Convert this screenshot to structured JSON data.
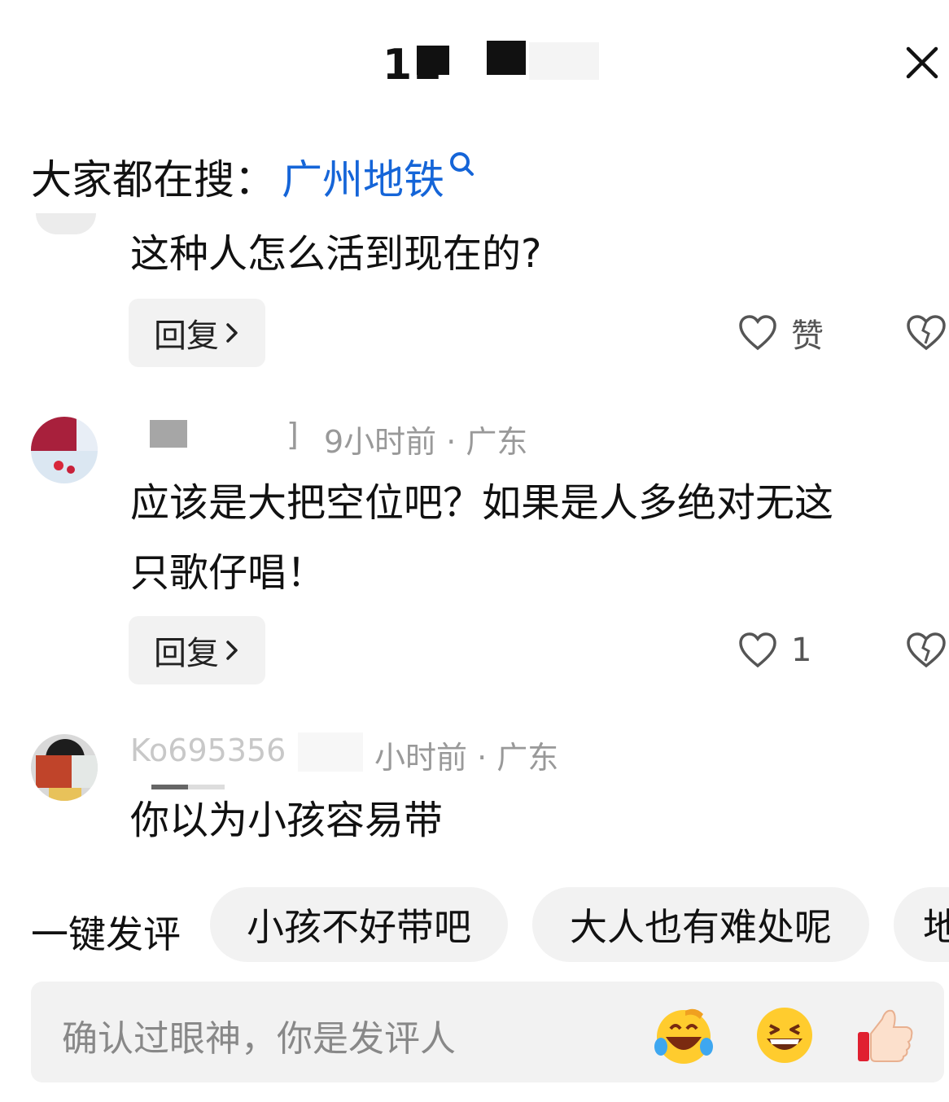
{
  "header": {
    "title": "11"
  },
  "hot_search": {
    "label": "大家都在搜：",
    "term": "广州地铁"
  },
  "comments": [
    {
      "text": "这种人怎么活到现在的?",
      "reply_label": "回复",
      "like_label": "赞"
    },
    {
      "username_suffix": "]",
      "meta": "9小时前 · 广东",
      "text_line1": "应该是大把空位吧？如果是人多绝对无这",
      "text_line2": "只歌仔唱！",
      "reply_label": "回复",
      "like_count": "1"
    },
    {
      "username_partial": "Ko695356",
      "meta": "小时前 · 广东",
      "text": "你以为小孩容易带"
    }
  ],
  "quick_comment": {
    "label": "一键发评",
    "chips": [
      "小孩不好带吧",
      "大人也有难处呢",
      "地"
    ]
  },
  "input": {
    "placeholder": "确认过眼神，你是发评人"
  },
  "colors": {
    "link": "#1565d8",
    "chip_bg": "#f2f2f2",
    "meta_gray": "#999999"
  }
}
